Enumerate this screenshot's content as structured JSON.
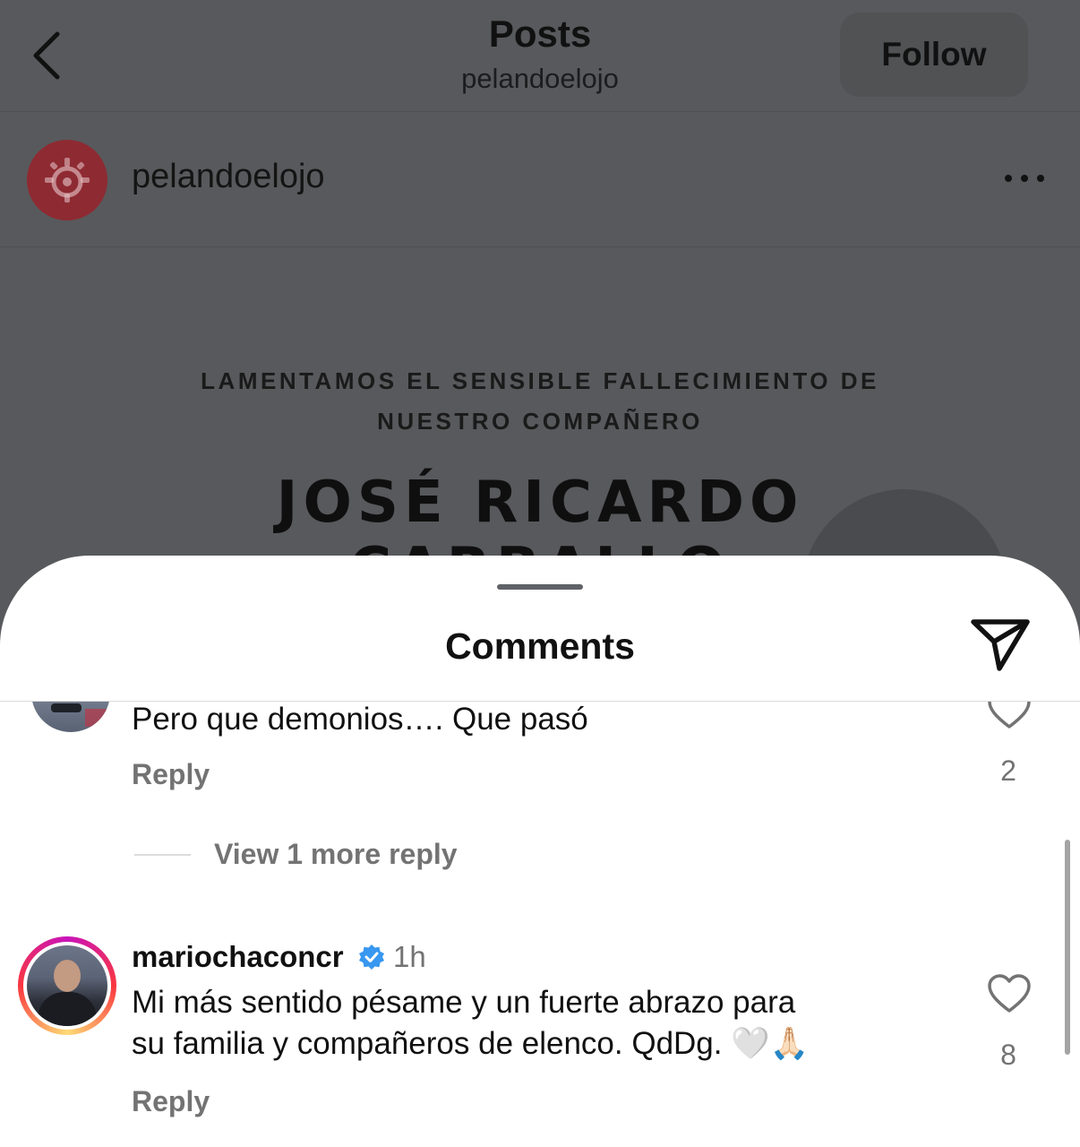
{
  "header": {
    "title": "Posts",
    "subtitle": "pelandoelojo",
    "follow_label": "Follow"
  },
  "post": {
    "account_name": "pelandoelojo",
    "image_text_line1": "LAMENTAMOS EL SENSIBLE FALLECIMIENTO DE",
    "image_text_line2": "NUESTRO COMPAÑERO",
    "image_text_name": "JOSÉ RICARDO",
    "image_text_name2": "CARBALLO"
  },
  "comments_sheet": {
    "title": "Comments",
    "comments": [
      {
        "text": "Pero que demonios…. Que pasó",
        "reply_label": "Reply",
        "likes": "2"
      },
      {
        "view_more": "View 1 more reply"
      },
      {
        "username": "mariochaconcr",
        "time": "1h",
        "text_line1": "Mi más sentido pésame y un fuerte abrazo para",
        "text_line2": "su familia y compañeros de elenco.  QdDg. 🤍🙏🏻",
        "reply_label": "Reply",
        "likes": "8"
      }
    ]
  },
  "colors": {
    "dim_overlay": "#58595c",
    "verified": "#3897f0",
    "secondary_text": "#737373"
  },
  "icons": [
    "back-chevron-icon",
    "logo-icon",
    "more-icon",
    "share-icon",
    "heart-icon",
    "verified-icon"
  ]
}
